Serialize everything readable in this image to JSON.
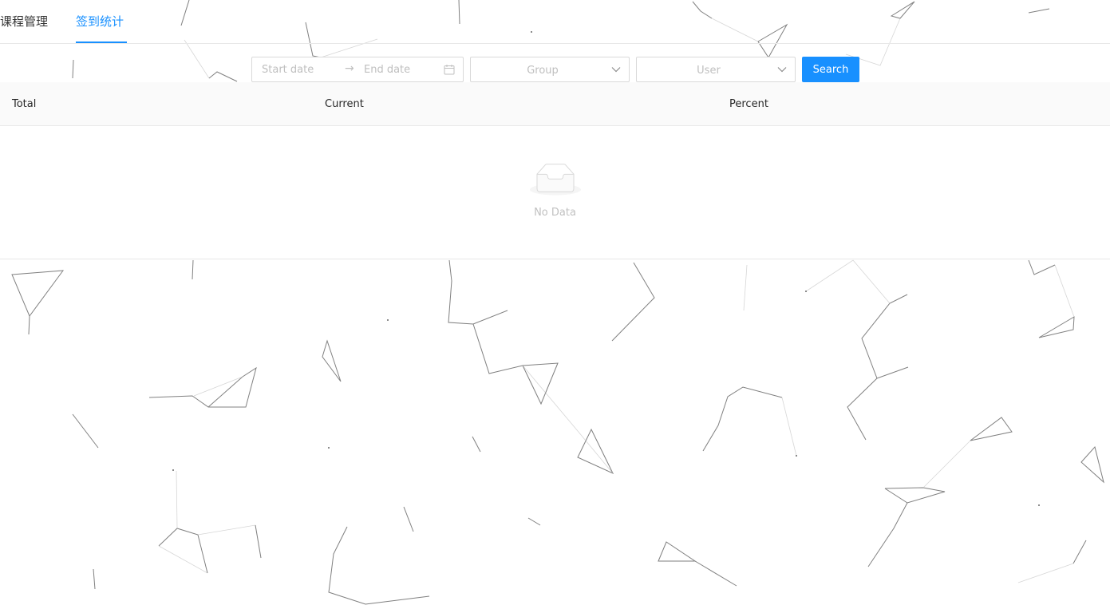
{
  "tabs": {
    "course_management": "课程管理",
    "signin_statistics": "签到统计",
    "active": "签到统计"
  },
  "filters": {
    "date_range": {
      "start_placeholder": "Start date",
      "separator": "→",
      "end_placeholder": "End date"
    },
    "group_select": {
      "placeholder": "Group"
    },
    "user_select": {
      "placeholder": "User"
    },
    "search_button": "Search"
  },
  "table": {
    "columns": [
      "Total",
      "Current",
      "Percent"
    ],
    "rows": [],
    "empty_text": "No Data"
  },
  "colors": {
    "accent": "#1890ff",
    "header_bg": "#fafafa",
    "border": "#e8e8e8",
    "placeholder": "#bfbfbf"
  },
  "icons": {
    "date_picker": "calendar-icon",
    "select_arrow": "chevron-down-icon",
    "empty_state": "empty-inbox-icon"
  }
}
